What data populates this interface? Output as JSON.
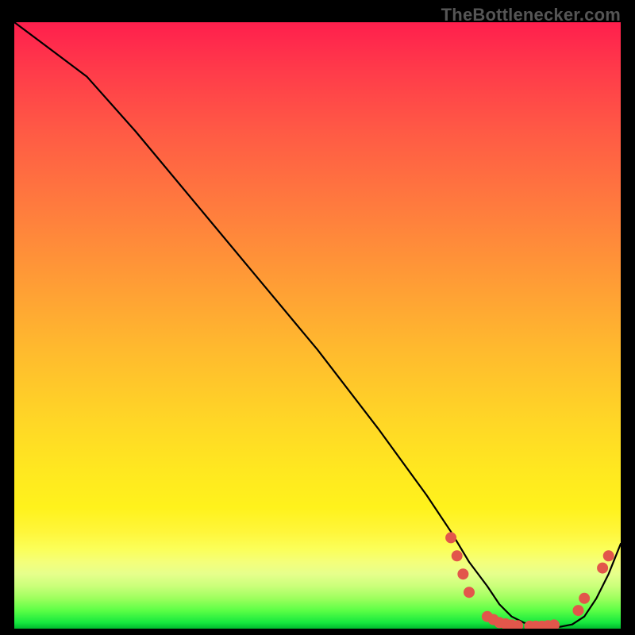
{
  "watermark": "TheBottlenecker.com",
  "colors": {
    "background": "#000000",
    "curve": "#000000",
    "dots": "#e2564b",
    "gradient_top": "#ff1f4d",
    "gradient_bottom": "#00b82e"
  },
  "chart_data": {
    "type": "line",
    "title": "",
    "xlabel": "",
    "ylabel": "",
    "xlim": [
      0,
      100
    ],
    "ylim": [
      0,
      100
    ],
    "grid": false,
    "legend": false,
    "series": [
      {
        "name": "bottleneck-curve",
        "x": [
          0,
          4,
          8,
          12,
          20,
          30,
          40,
          50,
          60,
          68,
          72,
          75,
          78,
          80,
          82,
          84,
          86,
          88,
          90,
          92,
          94,
          96,
          98,
          100
        ],
        "y": [
          100,
          97,
          94,
          91,
          82,
          70,
          58,
          46,
          33,
          22,
          16,
          11,
          7,
          4,
          2,
          1,
          0.5,
          0.3,
          0.3,
          0.7,
          2,
          5,
          9,
          14
        ]
      }
    ],
    "markers": [
      {
        "name": "cluster-left",
        "x": 72,
        "y": 15
      },
      {
        "name": "cluster-left",
        "x": 73,
        "y": 12
      },
      {
        "name": "cluster-left",
        "x": 74,
        "y": 9
      },
      {
        "name": "cluster-left",
        "x": 75,
        "y": 6
      },
      {
        "name": "cluster-flat",
        "x": 78,
        "y": 2
      },
      {
        "name": "cluster-flat",
        "x": 79,
        "y": 1.5
      },
      {
        "name": "cluster-flat",
        "x": 80,
        "y": 1
      },
      {
        "name": "cluster-flat",
        "x": 81,
        "y": 0.8
      },
      {
        "name": "cluster-flat",
        "x": 82,
        "y": 0.6
      },
      {
        "name": "cluster-flat",
        "x": 83,
        "y": 0.5
      },
      {
        "name": "cluster-flat",
        "x": 85,
        "y": 0.4
      },
      {
        "name": "cluster-flat",
        "x": 86,
        "y": 0.4
      },
      {
        "name": "cluster-flat",
        "x": 87,
        "y": 0.4
      },
      {
        "name": "cluster-flat",
        "x": 88,
        "y": 0.5
      },
      {
        "name": "cluster-flat",
        "x": 89,
        "y": 0.6
      },
      {
        "name": "cluster-right",
        "x": 93,
        "y": 3
      },
      {
        "name": "cluster-right",
        "x": 94,
        "y": 5
      },
      {
        "name": "cluster-right",
        "x": 97,
        "y": 10
      },
      {
        "name": "cluster-right",
        "x": 98,
        "y": 12
      }
    ]
  }
}
